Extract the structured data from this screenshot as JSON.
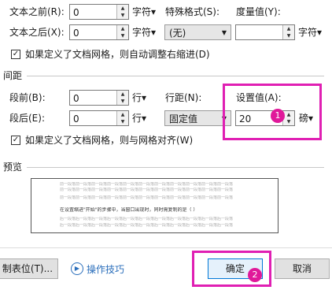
{
  "indent": {
    "before_label": "文本之前(R):",
    "before_value": "0",
    "before_unit": "字符▾",
    "after_label": "文本之后(X):",
    "after_value": "0",
    "after_unit": "字符▾",
    "special_label": "特殊格式(S):",
    "special_value": "(无)",
    "measure_label": "度量值(Y):",
    "measure_value": "",
    "measure_unit": "字符▾",
    "grid_checkbox_label": "如果定义了文档网格，则自动调整右缩进(D)"
  },
  "spacing": {
    "section_title": "间距",
    "before_label": "段前(B):",
    "before_value": "0",
    "before_unit": "行▾",
    "after_label": "段后(E):",
    "after_value": "0",
    "after_unit": "行▾",
    "line_label": "行距(N):",
    "line_value": "固定值",
    "setting_label": "设置值(A):",
    "setting_value": "20",
    "setting_unit": "磅▾",
    "grid_checkbox_label": "如果定义了文档网格，则与网格对齐(W)"
  },
  "preview": {
    "title": "预览",
    "prev_line": "前一段落前一段落前一段落前一段落前一段落前一段落前一段落前一段落前一段落前一段落前一段落",
    "sample_line": "在设置缩进\"开始\"的步骤中，当窗口出现时，同时需复制的是（  ）",
    "next_line": "后一段落后一段落后一段落后一段落后一段落后一段落后一段落后一段落后一段落后一段落后一段落"
  },
  "footer": {
    "tabs_button": "制表位(T)...",
    "tips_link": "操作技巧",
    "ok_button": "确定",
    "cancel_button": "取消"
  },
  "annotations": {
    "badge_1": "1",
    "badge_2": "2"
  },
  "colors": {
    "highlight": "#e01fb3",
    "badge": "#e0199a",
    "link": "#2a6ebb"
  }
}
